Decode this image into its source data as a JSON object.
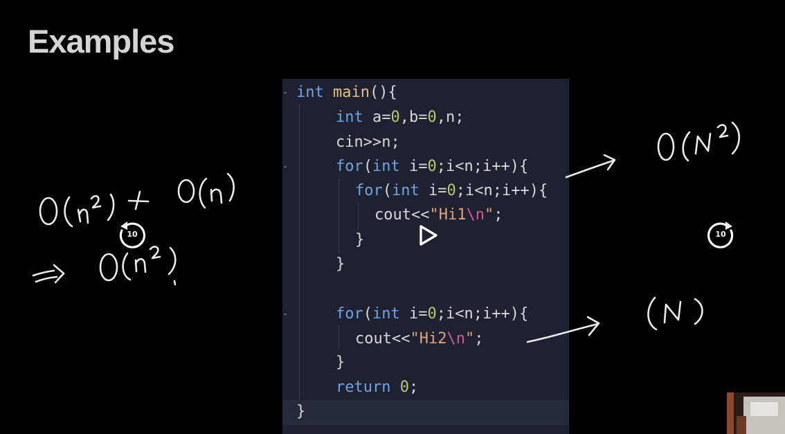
{
  "slide": {
    "title": "Examples"
  },
  "code": {
    "line1": {
      "kw": "int",
      "fn": "main",
      "rest": "(){"
    },
    "line2": {
      "kw": "int",
      "p1": " a=",
      "n1": "0",
      "p2": ",b=",
      "n2": "0",
      "p3": ",n;"
    },
    "line3": {
      "text": "cin>>n;"
    },
    "line4": {
      "kw1": "for",
      "p1": "(",
      "kw2": "int",
      "p2": " i=",
      "n1": "0",
      "p3": ";i<n;i++){"
    },
    "line5": {
      "kw1": "for",
      "p1": "(",
      "kw2": "int",
      "p2": " i=",
      "n1": "0",
      "p3": ";i<n;i++){"
    },
    "line6": {
      "p1": "cout<<",
      "s1": "\"Hi1",
      "e1": "\\n",
      "s2": "\"",
      "p2": ";"
    },
    "line7": {
      "text": "}"
    },
    "line8": {
      "text": "}"
    },
    "line9": {
      "kw1": "for",
      "p1": "(",
      "kw2": "int",
      "p2": " i=",
      "n1": "0",
      "p3": ";i<n;i++){"
    },
    "line10": {
      "p1": "cout<<",
      "s1": "\"Hi2",
      "e1": "\\n",
      "s2": "\"",
      "p2": ";"
    },
    "line11": {
      "text": "}"
    },
    "line12": {
      "kw": "return",
      "n1": "0",
      "p1": ";"
    },
    "line13": {
      "text": "}"
    }
  },
  "player": {
    "rewind_seconds": "10",
    "forward_seconds": "10",
    "play_icon": "play-icon",
    "rewind_icon": "rewind-10-icon",
    "forward_icon": "forward-10-icon"
  }
}
